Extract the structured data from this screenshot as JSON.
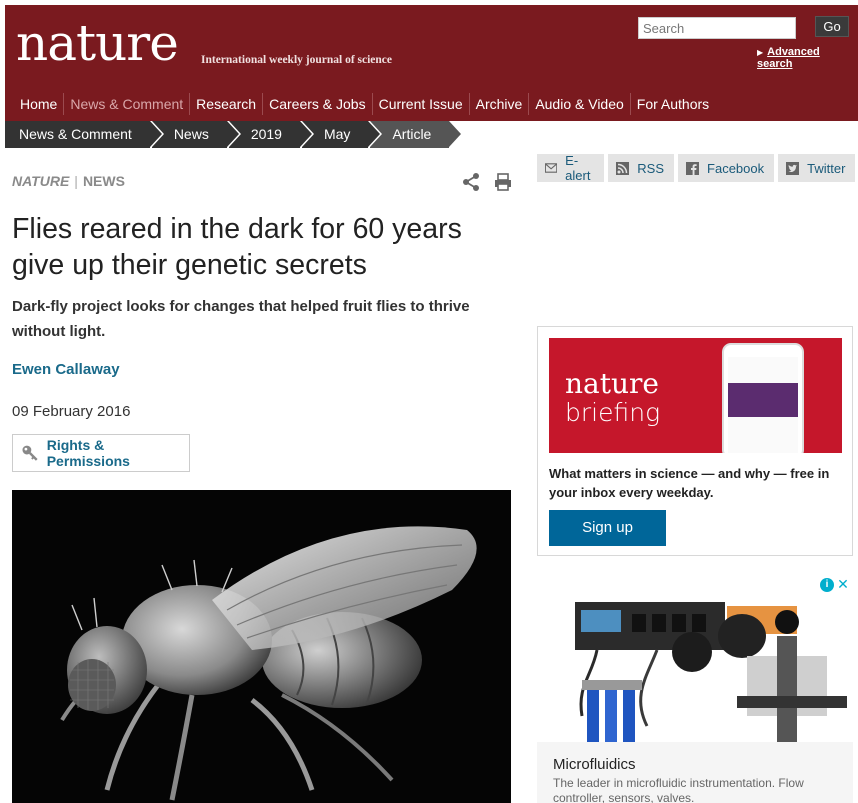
{
  "header": {
    "logo": "nature",
    "tagline": "International weekly journal of science",
    "search_placeholder": "Search",
    "go_label": "Go",
    "advanced_search": "Advanced search"
  },
  "nav": {
    "items": [
      {
        "label": "Home"
      },
      {
        "label": "News & Comment",
        "active": true
      },
      {
        "label": "Research"
      },
      {
        "label": "Careers & Jobs"
      },
      {
        "label": "Current Issue"
      },
      {
        "label": "Archive"
      },
      {
        "label": "Audio & Video"
      },
      {
        "label": "For Authors"
      }
    ]
  },
  "breadcrumb": [
    "News & Comment",
    "News",
    "2019",
    "May",
    "Article"
  ],
  "article": {
    "journal": "NATURE",
    "section": "NEWS",
    "title": "Flies reared in the dark for 60 years give up their genetic secrets",
    "standfirst": "Dark-fly project looks for changes that helped fruit flies to thrive without light.",
    "author": "Ewen Callaway",
    "date": "09 February 2016",
    "rights": "Rights & Permissions"
  },
  "social": {
    "ealert": "E-alert",
    "rss": "RSS",
    "facebook": "Facebook",
    "twitter": "Twitter"
  },
  "promo": {
    "brand_top": "nature",
    "brand_bottom": "briefing",
    "text": "What matters in science — and why — free in your inbox every weekday.",
    "signup": "Sign up"
  },
  "ad": {
    "title": "Microfluidics",
    "description": "The leader in microfluidic instrumentation. Flow controller, sensors, valves."
  },
  "colors": {
    "masthead": "#7a1a1f",
    "link": "#1a6a8a",
    "signup": "#006699",
    "briefing_red": "#c5172b"
  }
}
